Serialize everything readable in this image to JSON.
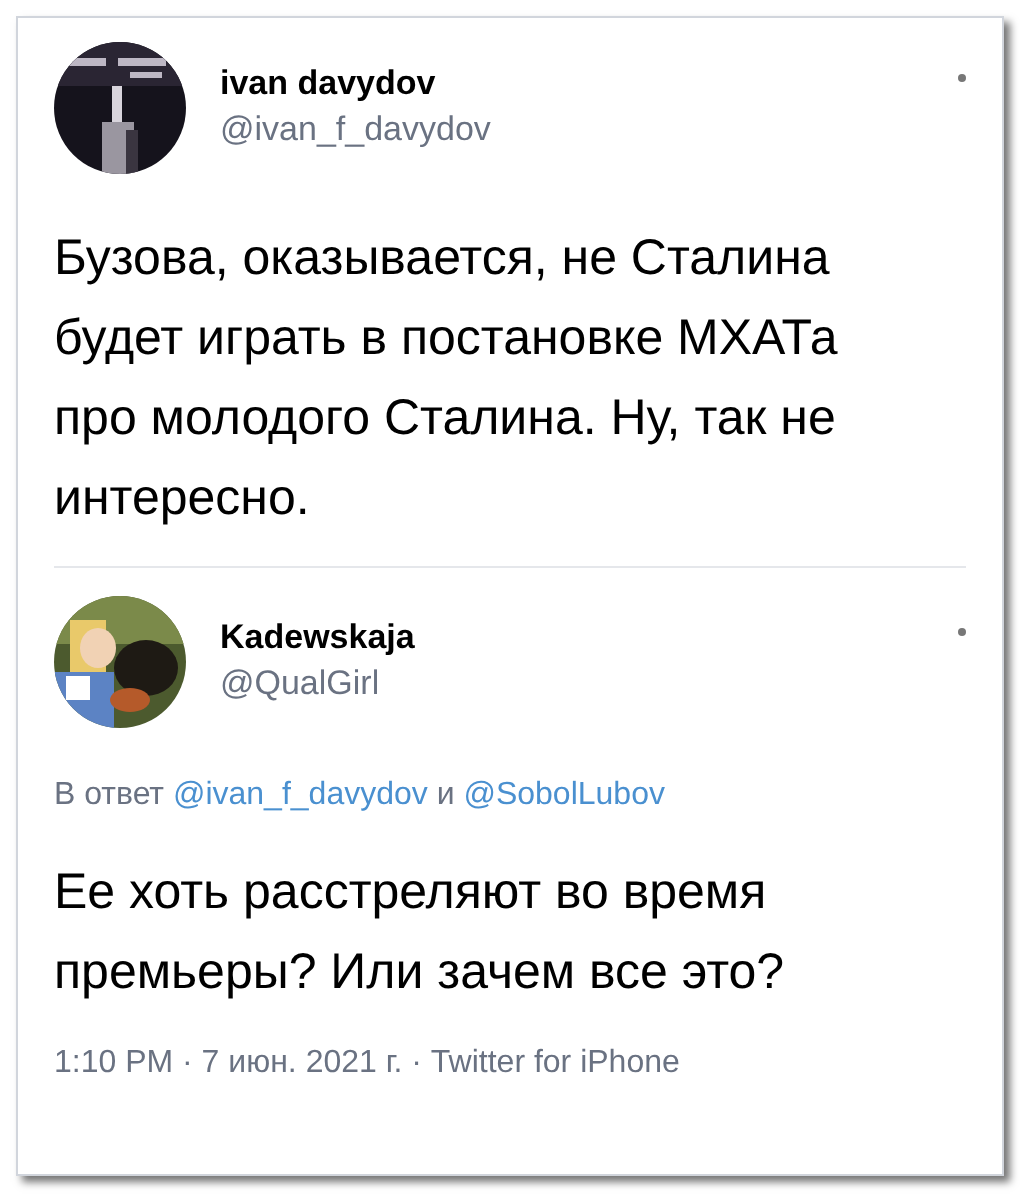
{
  "tweets": [
    {
      "name": "ivan davydov",
      "handle": "@ivan_f_davydov",
      "text": "Бузова, оказывается, не Сталина будет играть в постановке МХАТа про молодого Сталина. Ну, так не интересно."
    },
    {
      "name": "Kadewskaja",
      "handle": "@QualGirl",
      "reply": {
        "prefix": "В ответ",
        "mentions": [
          "@ivan_f_davydov",
          "@SobolLubov"
        ],
        "joiner": "и"
      },
      "text": "Ее хоть расстреляют во время премьеры? Или зачем все это?",
      "meta": "1:10 PM · 7 июн. 2021 г. · Twitter for iPhone"
    }
  ]
}
